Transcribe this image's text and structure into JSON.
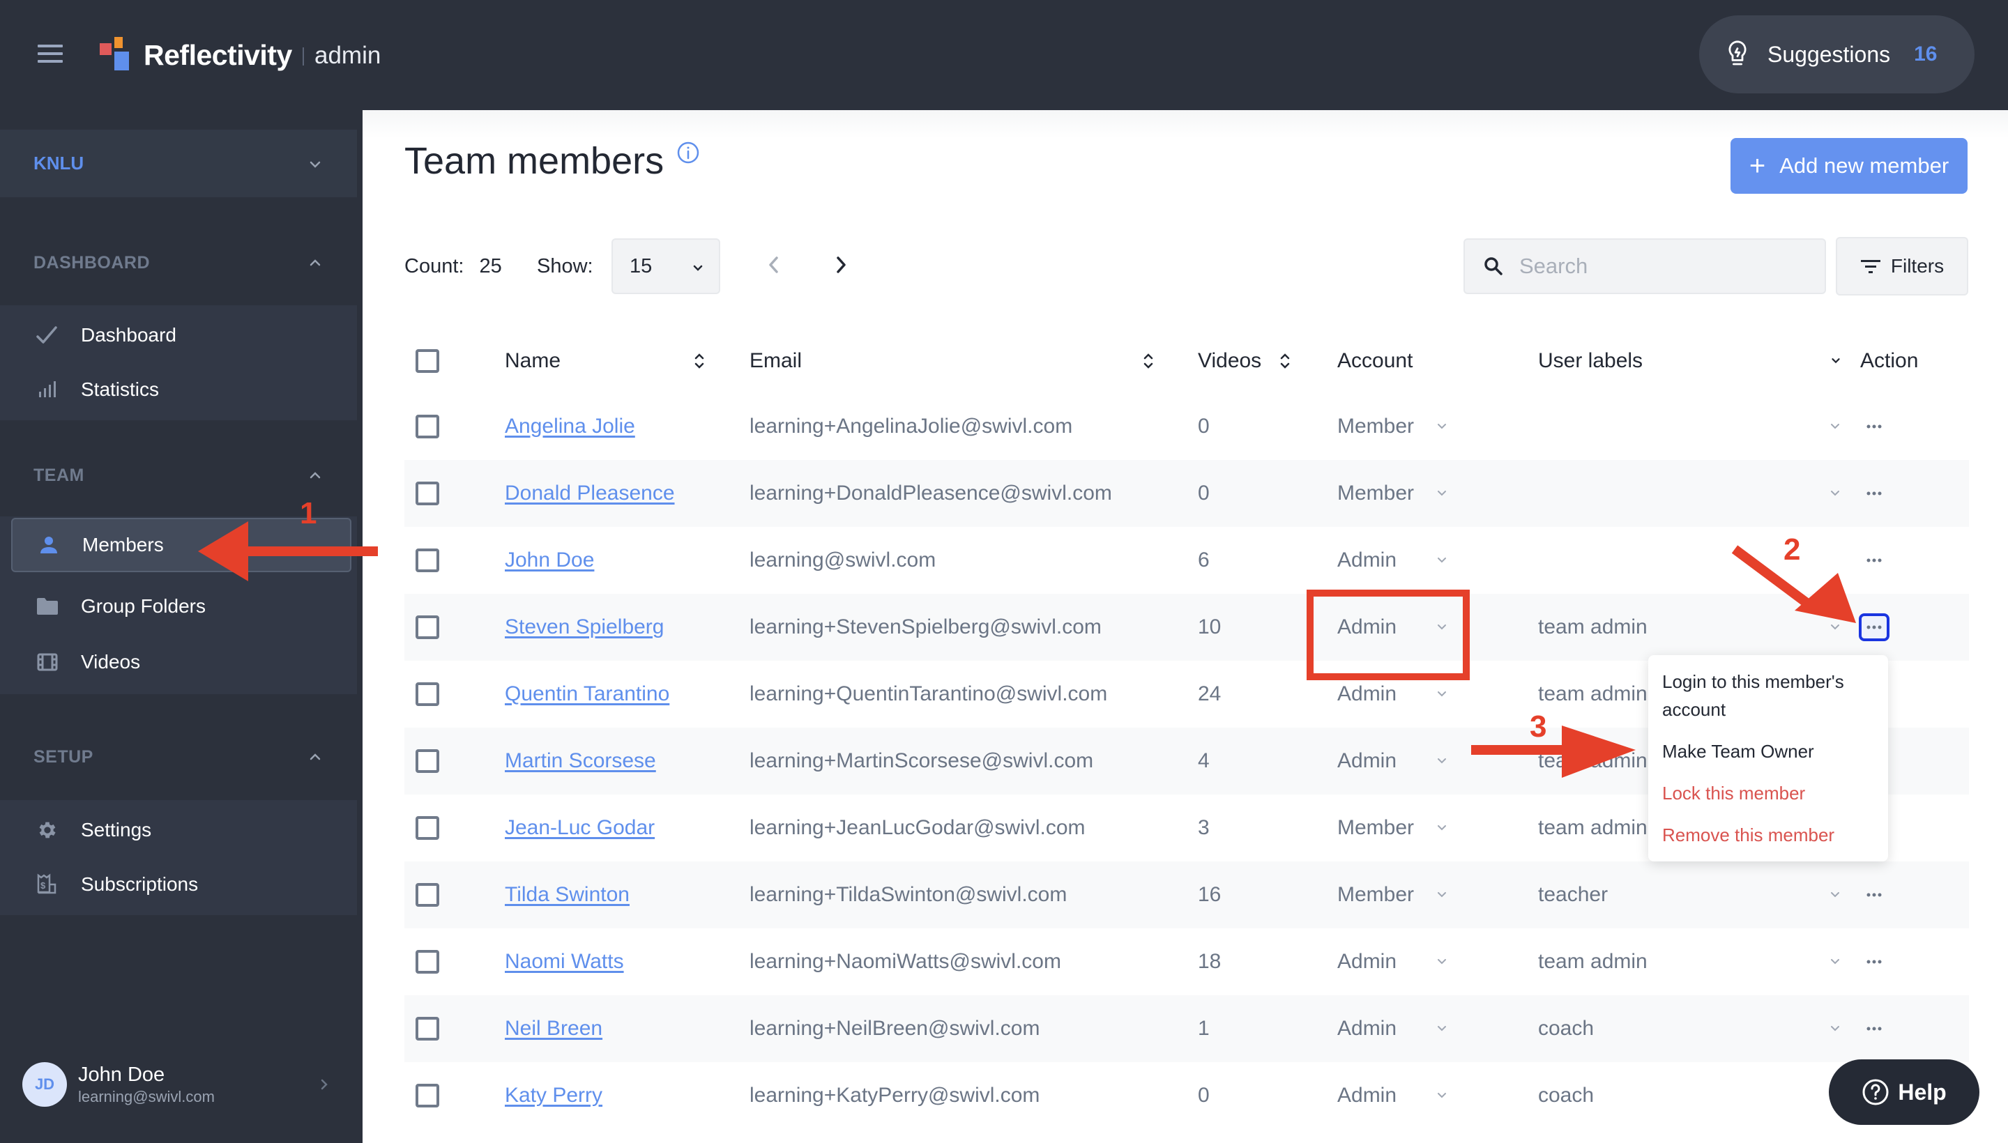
{
  "app": {
    "brand": "Reflectivity",
    "brand_suffix": "admin",
    "suggestions_label": "Suggestions",
    "suggestions_count": "16"
  },
  "sidebar": {
    "team_name": "KNLU",
    "sections": [
      {
        "title": "DASHBOARD",
        "items": [
          {
            "label": "Dashboard",
            "icon": "trend-line-icon"
          },
          {
            "label": "Statistics",
            "icon": "bar-chart-icon"
          }
        ]
      },
      {
        "title": "TEAM",
        "items": [
          {
            "label": "Members",
            "icon": "person-icon",
            "active": true
          },
          {
            "label": "Group Folders",
            "icon": "folder-icon"
          },
          {
            "label": "Videos",
            "icon": "film-icon"
          }
        ]
      },
      {
        "title": "SETUP",
        "items": [
          {
            "label": "Settings",
            "icon": "gear-icon"
          },
          {
            "label": "Subscriptions",
            "icon": "receipt-dollar-icon"
          }
        ]
      }
    ],
    "user": {
      "initials": "JD",
      "name": "John Doe",
      "email": "learning@swivl.com"
    }
  },
  "main": {
    "title": "Team members",
    "add_button": "Add new member",
    "count_label": "Count:",
    "count_value": "25",
    "show_label": "Show:",
    "show_value": "15",
    "search_placeholder": "Search",
    "filters_label": "Filters",
    "columns": {
      "name": "Name",
      "email": "Email",
      "videos": "Videos",
      "account": "Account",
      "user_labels": "User labels",
      "action": "Action"
    },
    "rows": [
      {
        "name": "Angelina Jolie",
        "email": "learning+AngelinaJolie@swivl.com",
        "videos": "0",
        "account": "Member",
        "label": ""
      },
      {
        "name": "Donald Pleasence",
        "email": "learning+DonaldPleasence@swivl.com",
        "videos": "0",
        "account": "Member",
        "label": ""
      },
      {
        "name": "John Doe",
        "email": "learning@swivl.com",
        "videos": "6",
        "account": "Admin",
        "label": ""
      },
      {
        "name": "Steven Spielberg",
        "email": "learning+StevenSpielberg@swivl.com",
        "videos": "10",
        "account": "Admin",
        "label": "team admin"
      },
      {
        "name": "Quentin Tarantino",
        "email": "learning+QuentinTarantino@swivl.com",
        "videos": "24",
        "account": "Admin",
        "label": "team admin"
      },
      {
        "name": "Martin Scorsese",
        "email": "learning+MartinScorsese@swivl.com",
        "videos": "4",
        "account": "Admin",
        "label": "team admin"
      },
      {
        "name": "Jean-Luc Godar",
        "email": "learning+JeanLucGodar@swivl.com",
        "videos": "3",
        "account": "Member",
        "label": "team admin"
      },
      {
        "name": "Tilda Swinton",
        "email": "learning+TildaSwinton@swivl.com",
        "videos": "16",
        "account": "Member",
        "label": "teacher"
      },
      {
        "name": "Naomi Watts",
        "email": "learning+NaomiWatts@swivl.com",
        "videos": "18",
        "account": "Admin",
        "label": "team admin"
      },
      {
        "name": "Neil Breen",
        "email": "learning+NeilBreen@swivl.com",
        "videos": "1",
        "account": "Admin",
        "label": "coach"
      },
      {
        "name": "Katy Perry",
        "email": "learning+KatyPerry@swivl.com",
        "videos": "0",
        "account": "Admin",
        "label": "coach"
      }
    ],
    "action_menu": {
      "items": [
        {
          "label": "Login to this member's account",
          "style": "dark"
        },
        {
          "label": "Make Team Owner",
          "style": "dark"
        },
        {
          "label": "Lock this member",
          "style": "danger"
        },
        {
          "label": "Remove this member",
          "style": "danger"
        }
      ]
    }
  },
  "help_label": "Help",
  "annotations": {
    "step1": "1",
    "step2": "2",
    "step3": "3"
  },
  "colors": {
    "accent": "#5f8fec",
    "annotation": "#e5402a",
    "danger": "#d9534f",
    "header_bg": "#2c313c"
  }
}
